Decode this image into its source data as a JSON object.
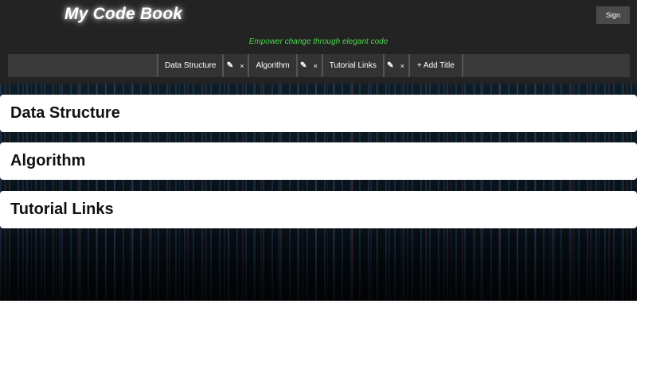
{
  "header": {
    "logo": "My Code Book",
    "sign_label": "Sign",
    "tagline": "Empower change through elegant code"
  },
  "nav": {
    "tabs": [
      {
        "label": "Data Structure",
        "edit_icon": "pencil-icon",
        "edit_glyph": "✎",
        "close_glyph": "×"
      },
      {
        "label": "Algorithm",
        "edit_icon": "pencil-icon",
        "edit_glyph": "✎",
        "close_glyph": "×"
      },
      {
        "label": "Tutorial Links",
        "edit_icon": "pencil-icon",
        "edit_glyph": "✎",
        "close_glyph": "×"
      }
    ],
    "add_label": "+ Add Title"
  },
  "sections": [
    {
      "title": "Data Structure"
    },
    {
      "title": "Algorithm"
    },
    {
      "title": "Tutorial Links"
    }
  ],
  "colors": {
    "header_bg": "#232323",
    "nav_bg": "#3a3a3a",
    "tagline": "#4ad84a"
  }
}
